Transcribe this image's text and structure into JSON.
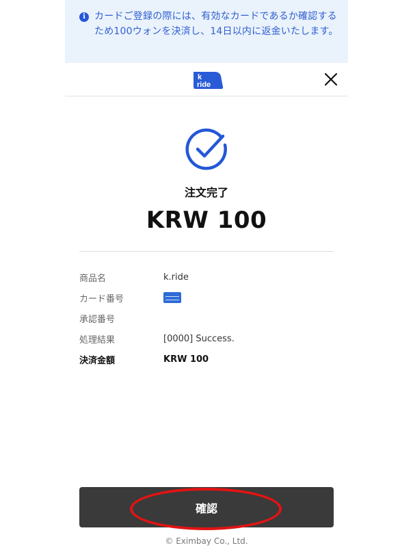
{
  "notice": {
    "icon": "info-icon",
    "text": "カードご登録の際には、有効なカードであるか確認するため100ウォンを決済し、14日以内に返金いたします。"
  },
  "header": {
    "logo_text_top": "k",
    "logo_text_bottom": "ride",
    "close_icon": "close-icon"
  },
  "result": {
    "icon": "check-circle-icon",
    "title": "注文完了",
    "amount": "KRW 100"
  },
  "details": {
    "product_label": "商品名",
    "product_value": "k.ride",
    "card_label": "カード番号",
    "card_brand_icon": "amex-card-icon",
    "approval_label": "承認番号",
    "approval_value": "",
    "result_label": "処理結果",
    "result_value": "[0000] Success.",
    "amount_label": "決済金額",
    "amount_value": "KRW 100"
  },
  "actions": {
    "confirm_label": "確認"
  },
  "footer": {
    "copyright": "© Eximbay Co., Ltd."
  },
  "colors": {
    "accent": "#2457d8",
    "notice_bg": "#eaf2fc",
    "button_bg": "#3a3a3a",
    "highlight": "#e31313"
  }
}
